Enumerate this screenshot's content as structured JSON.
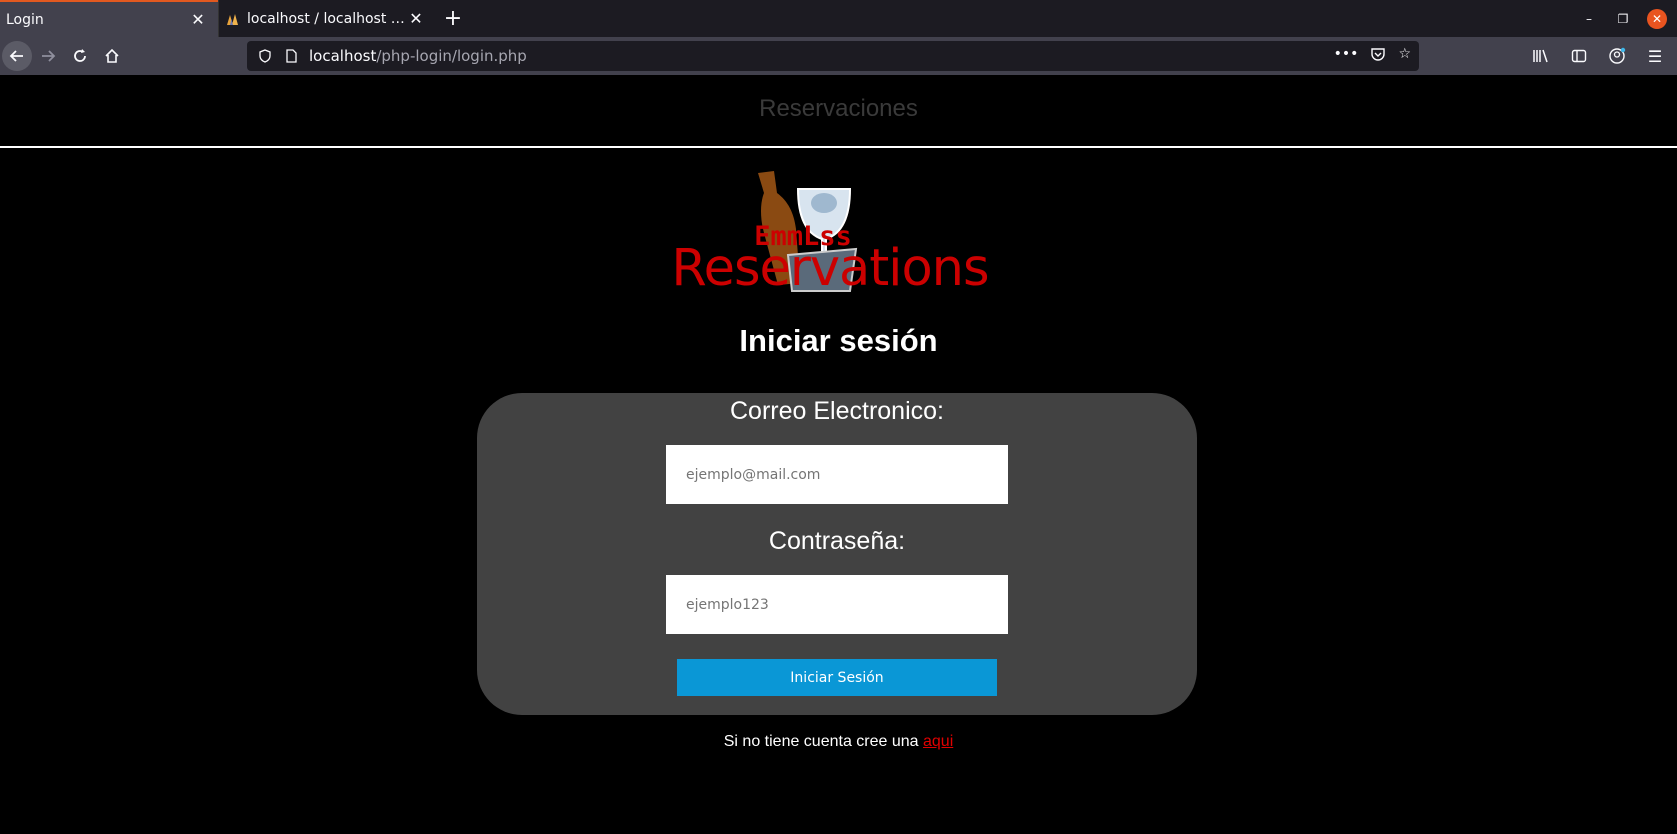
{
  "browser": {
    "tabs": [
      {
        "title": "Login",
        "active": true
      },
      {
        "title": "localhost / localhost / usuarios",
        "active": false
      }
    ],
    "url": {
      "host": "localhost",
      "path": "/php-login/login.php"
    }
  },
  "page": {
    "header": {
      "brand": "Reservaciones"
    },
    "logo": {
      "top_text": "EmmLss",
      "main_text": "Reservations"
    },
    "heading": "Iniciar sesión",
    "form": {
      "email_label": "Correo Electronico:",
      "email_placeholder": "ejemplo@mail.com",
      "password_label": "Contraseña:",
      "password_placeholder": "ejemplo123",
      "submit_label": "Iniciar Sesión"
    },
    "signup": {
      "text": "Si no tiene cuenta cree una ",
      "link": "aqui"
    }
  },
  "colors": {
    "accent_button": "#0a97d6",
    "logo_red": "#cc0000",
    "form_bg": "#424242",
    "link": "#e00000"
  },
  "icons": [
    "close-icon",
    "new-tab-icon",
    "back-icon",
    "forward-icon",
    "reload-icon",
    "home-icon",
    "shield-icon",
    "page-icon",
    "more-icon",
    "pocket-icon",
    "star-icon",
    "library-icon",
    "sidebar-icon",
    "account-icon",
    "menu-icon",
    "minimize-icon",
    "restore-icon",
    "window-close-icon"
  ]
}
